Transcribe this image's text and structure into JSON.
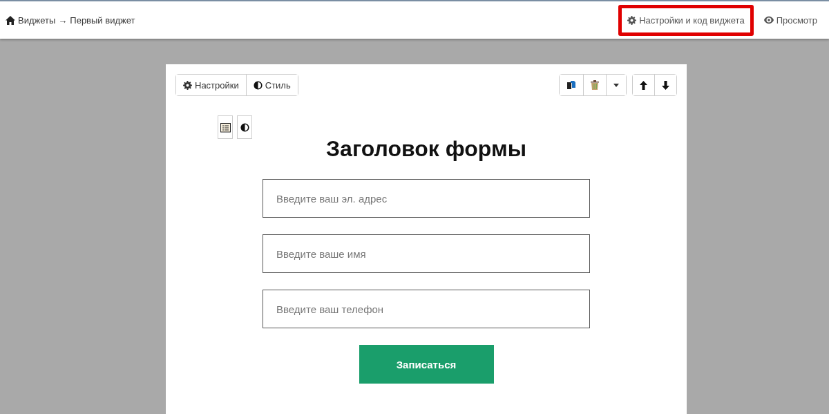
{
  "breadcrumb": {
    "root": "Виджеты",
    "separator": "→",
    "current": "Первый виджет"
  },
  "header_links": [
    {
      "label": "Настройки и код виджета",
      "highlighted": true
    },
    {
      "label": "Просмотр",
      "highlighted": false
    }
  ],
  "toolbar": {
    "tabs": [
      {
        "label": "Настройки"
      },
      {
        "label": "Стиль"
      }
    ]
  },
  "form": {
    "title": "Заголовок формы",
    "fields": [
      {
        "placeholder": "Введите ваш эл. адрес"
      },
      {
        "placeholder": "Введите ваше имя"
      },
      {
        "placeholder": "Введите ваш телефон"
      }
    ],
    "submit": "Записаться"
  }
}
